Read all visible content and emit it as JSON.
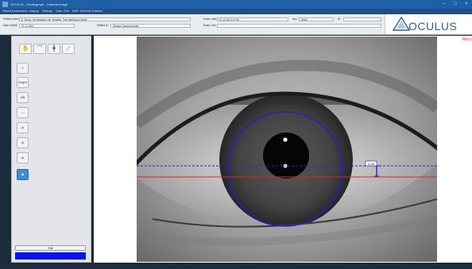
{
  "window": {
    "title": "OCULUS - Keratograph - Camera Image",
    "controls": {
      "minimize": "–",
      "maximize": "□",
      "close": "×"
    }
  },
  "menu": {
    "items": [
      "Patient",
      "Examination",
      "Display",
      "Settings",
      "Data",
      "Print",
      "EMR",
      "External Software"
    ]
  },
  "header": {
    "patient_name_label": "Patient name",
    "patient_name": "K_Demo_Keratograph, Mr. Imaging_Tear Meniscus Height",
    "dob_label": "Date of birth",
    "dob": "07.11.1967",
    "patient_id_label": "Patient ID",
    "patient_id": "Display Camera image",
    "exam_date_label": "Exam. date",
    "exam_date": "07.11.2013 13:45",
    "eye_label": "Eye",
    "eye": "Right",
    "id_label": "ID",
    "id_value": "",
    "exam_info_label": "Exam. Info",
    "exam_info": ""
  },
  "logo": {
    "text": "OCULUS"
  },
  "toolbar": {
    "icons": [
      "hand-icon",
      "eyelid-icon",
      "crosshair-icon",
      "measure-icon"
    ],
    "glyphs": [
      "✋",
      "⌒",
      "╋",
      "⟋"
    ]
  },
  "tools": [
    {
      "name": "pointer-tool-button",
      "label": "↖"
    },
    {
      "name": "zoom-tool-button",
      "label": "Bright"
    },
    {
      "name": "auto-tool-button",
      "label": "AB"
    },
    {
      "name": "line-tool-button",
      "label": "---"
    },
    {
      "name": "redness-tool-button",
      "label": "◉"
    },
    {
      "name": "meibo-tool-button",
      "label": "◉"
    },
    {
      "name": "tear-tool-button",
      "label": "◉"
    },
    {
      "name": "tmh-tool-button",
      "label": "◉"
    }
  ],
  "sidebar": {
    "export_label": "Edit"
  },
  "progress": {
    "value": 1.0,
    "color": "#0a14e6"
  },
  "measurement": {
    "label": "0.28",
    "circle_color": "#1f1fd6",
    "blue_line_color": "#2828c8",
    "red_line_color": "#d42a2a"
  },
  "status": {
    "text": "Reco"
  }
}
